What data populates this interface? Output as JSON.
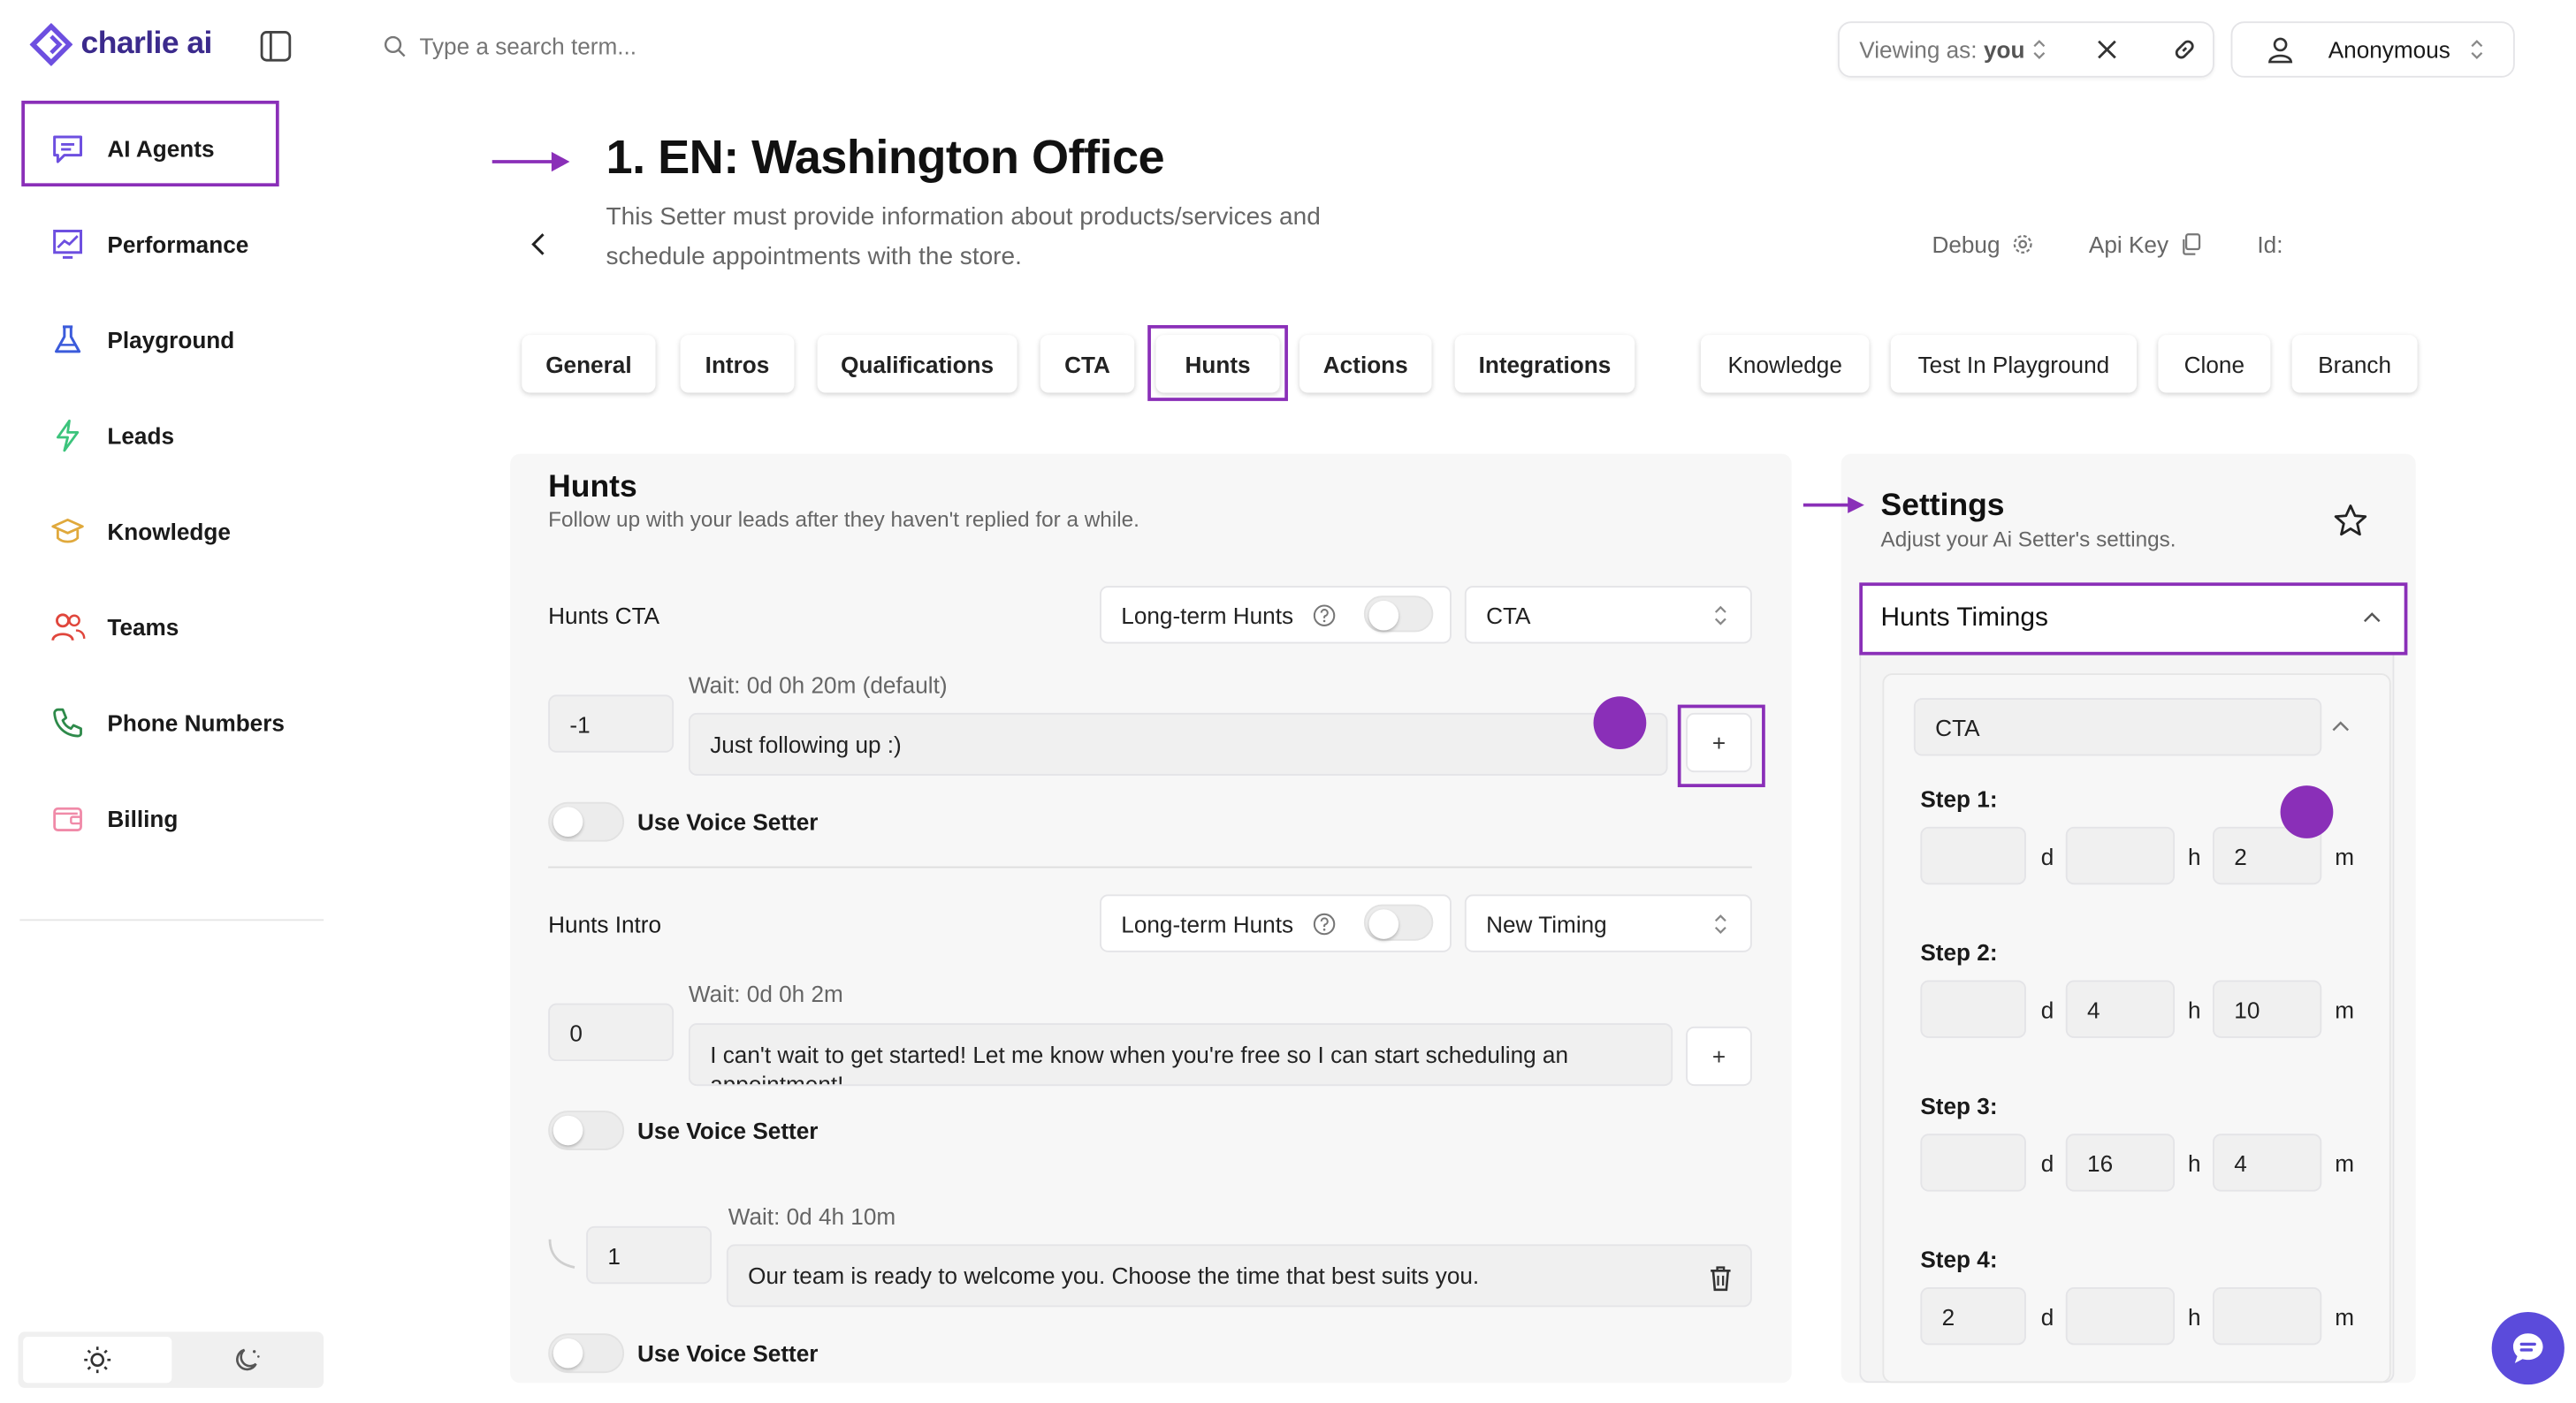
{
  "brand": {
    "name": "charlie ai",
    "accent": "#6d4fe0",
    "highlight": "#8a2fb8"
  },
  "sidebar": {
    "items": [
      {
        "label": "AI Agents",
        "icon": "chat-icon"
      },
      {
        "label": "Performance",
        "icon": "chart-icon"
      },
      {
        "label": "Playground",
        "icon": "flask-icon"
      },
      {
        "label": "Leads",
        "icon": "lightning-icon"
      },
      {
        "label": "Knowledge",
        "icon": "graduation-cap-icon"
      },
      {
        "label": "Teams",
        "icon": "users-icon"
      },
      {
        "label": "Phone Numbers",
        "icon": "phone-icon"
      },
      {
        "label": "Billing",
        "icon": "wallet-icon"
      }
    ]
  },
  "topbar": {
    "search_placeholder": "Type a search term...",
    "viewing_label": "Viewing as:",
    "viewing_user": "you",
    "account": "Anonymous"
  },
  "header": {
    "title": "1. EN: Washington Office",
    "description": "This Setter must provide information about products/services and schedule appointments with the store.",
    "debug": "Debug",
    "api_key": "Api Key",
    "id_label": "Id:"
  },
  "tabs": {
    "left": [
      "General",
      "Intros",
      "Qualifications",
      "CTA",
      "Hunts",
      "Actions",
      "Integrations"
    ],
    "right": [
      "Knowledge",
      "Test In Playground",
      "Clone",
      "Branch"
    ],
    "active": "Hunts"
  },
  "hunts": {
    "title": "Hunts",
    "subtitle": "Follow up with your leads after they haven't replied for a while.",
    "cta": {
      "label": "Hunts CTA",
      "longterm": "Long-term Hunts",
      "select": "CTA",
      "wait": "Wait: 0d 0h 20m (default)",
      "step": "-1",
      "message": "Just following up :)",
      "voice": "Use Voice Setter",
      "add": "+"
    },
    "intro": {
      "label": "Hunts Intro",
      "longterm": "Long-term Hunts",
      "select": "New Timing",
      "wait1": "Wait: 0d 0h 2m",
      "step1": "0",
      "message1": "I can't wait to get started! Let me know when you're free so I can start scheduling an appointment!",
      "voice1": "Use Voice Setter",
      "add": "+",
      "wait2": "Wait: 0d 4h 10m",
      "step2": "1",
      "message2": "Our team is ready to welcome you. Choose the time that best suits you.",
      "voice2": "Use Voice Setter"
    }
  },
  "settings": {
    "title": "Settings",
    "subtitle": "Adjust your Ai Setter's settings.",
    "section": "Hunts Timings",
    "select": "CTA",
    "units": {
      "d": "d",
      "h": "h",
      "m": "m"
    },
    "steps": [
      {
        "label": "Step 1:",
        "d": "",
        "h": "",
        "m": "2"
      },
      {
        "label": "Step 2:",
        "d": "",
        "h": "4",
        "m": "10"
      },
      {
        "label": "Step 3:",
        "d": "",
        "h": "16",
        "m": "4"
      },
      {
        "label": "Step 4:",
        "d": "2",
        "h": "",
        "m": ""
      }
    ]
  }
}
